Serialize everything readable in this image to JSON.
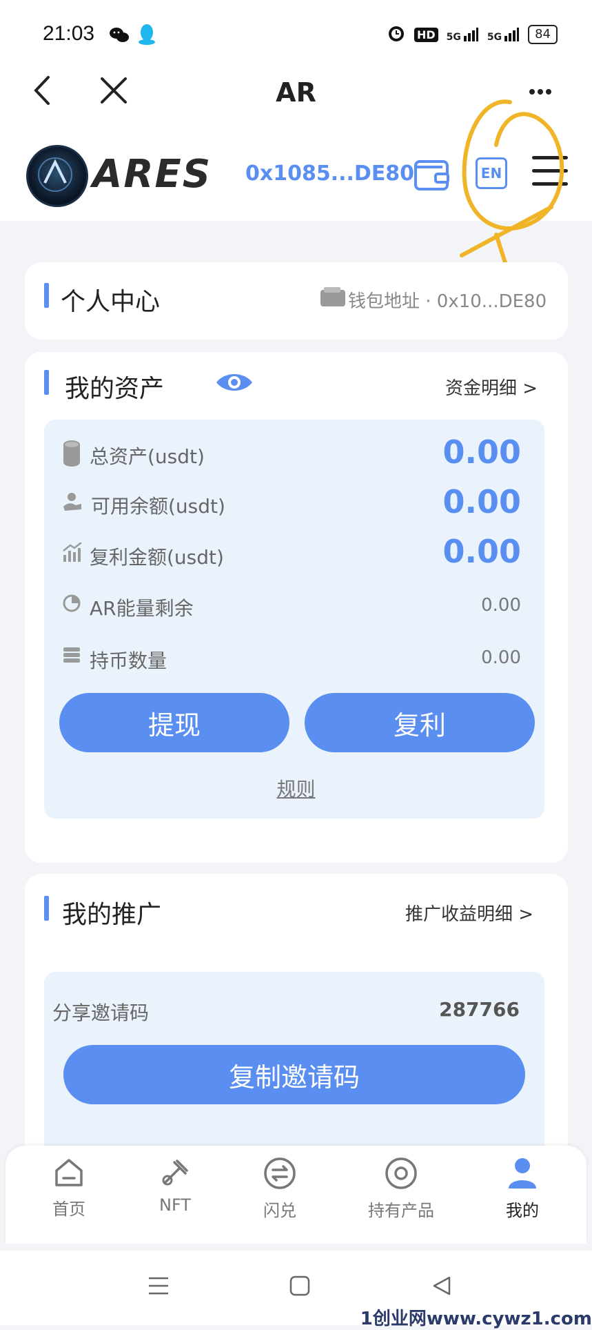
{
  "status_bar": {
    "time": "21:03",
    "hd_label": "HD",
    "network_label_1": "5G",
    "network_label_2": "5G",
    "battery": "84"
  },
  "app_bar": {
    "title": "AR"
  },
  "header": {
    "brand": "ARES",
    "wallet_address": "0x1085...DE80",
    "language_label": "EN"
  },
  "profile_card": {
    "title": "个人中心",
    "wallet_label": "钱包地址 · 0x10...DE80"
  },
  "assets_card": {
    "title": "我的资产",
    "detail_link": "资金明细 >",
    "rows": [
      {
        "label": "总资产(usdt)",
        "value": "0.00",
        "icon": "coins-icon"
      },
      {
        "label": "可用余额(usdt)",
        "value": "0.00",
        "icon": "wallet-hand-icon"
      },
      {
        "label": "复利金额(usdt)",
        "value": "0.00",
        "icon": "chart-icon"
      },
      {
        "label": "AR能量剩余",
        "value": "0.00",
        "icon": "pie-icon"
      },
      {
        "label": "持币数量",
        "value": "0.00",
        "icon": "stack-icon"
      }
    ],
    "withdraw_button": "提现",
    "compound_button": "复利",
    "rules_link": "规则"
  },
  "promotion_card": {
    "title": "我的推广",
    "detail_link": "推广收益明细 >",
    "invite_label": "分享邀请码",
    "invite_code": "287766",
    "copy_button": "复制邀请码"
  },
  "bottom_nav": {
    "items": [
      {
        "label": "首页",
        "icon": "home-icon"
      },
      {
        "label": "NFT",
        "icon": "nft-icon"
      },
      {
        "label": "闪兑",
        "icon": "swap-icon"
      },
      {
        "label": "持有产品",
        "icon": "target-icon"
      },
      {
        "label": "我的",
        "icon": "user-icon",
        "active": true
      }
    ]
  },
  "watermark": "1创业网www.cywz1.com",
  "colors": {
    "accent": "#5a8ef0",
    "panel": "#eaf3fc",
    "background": "#f2f4f7",
    "annotation": "#f0b429"
  }
}
